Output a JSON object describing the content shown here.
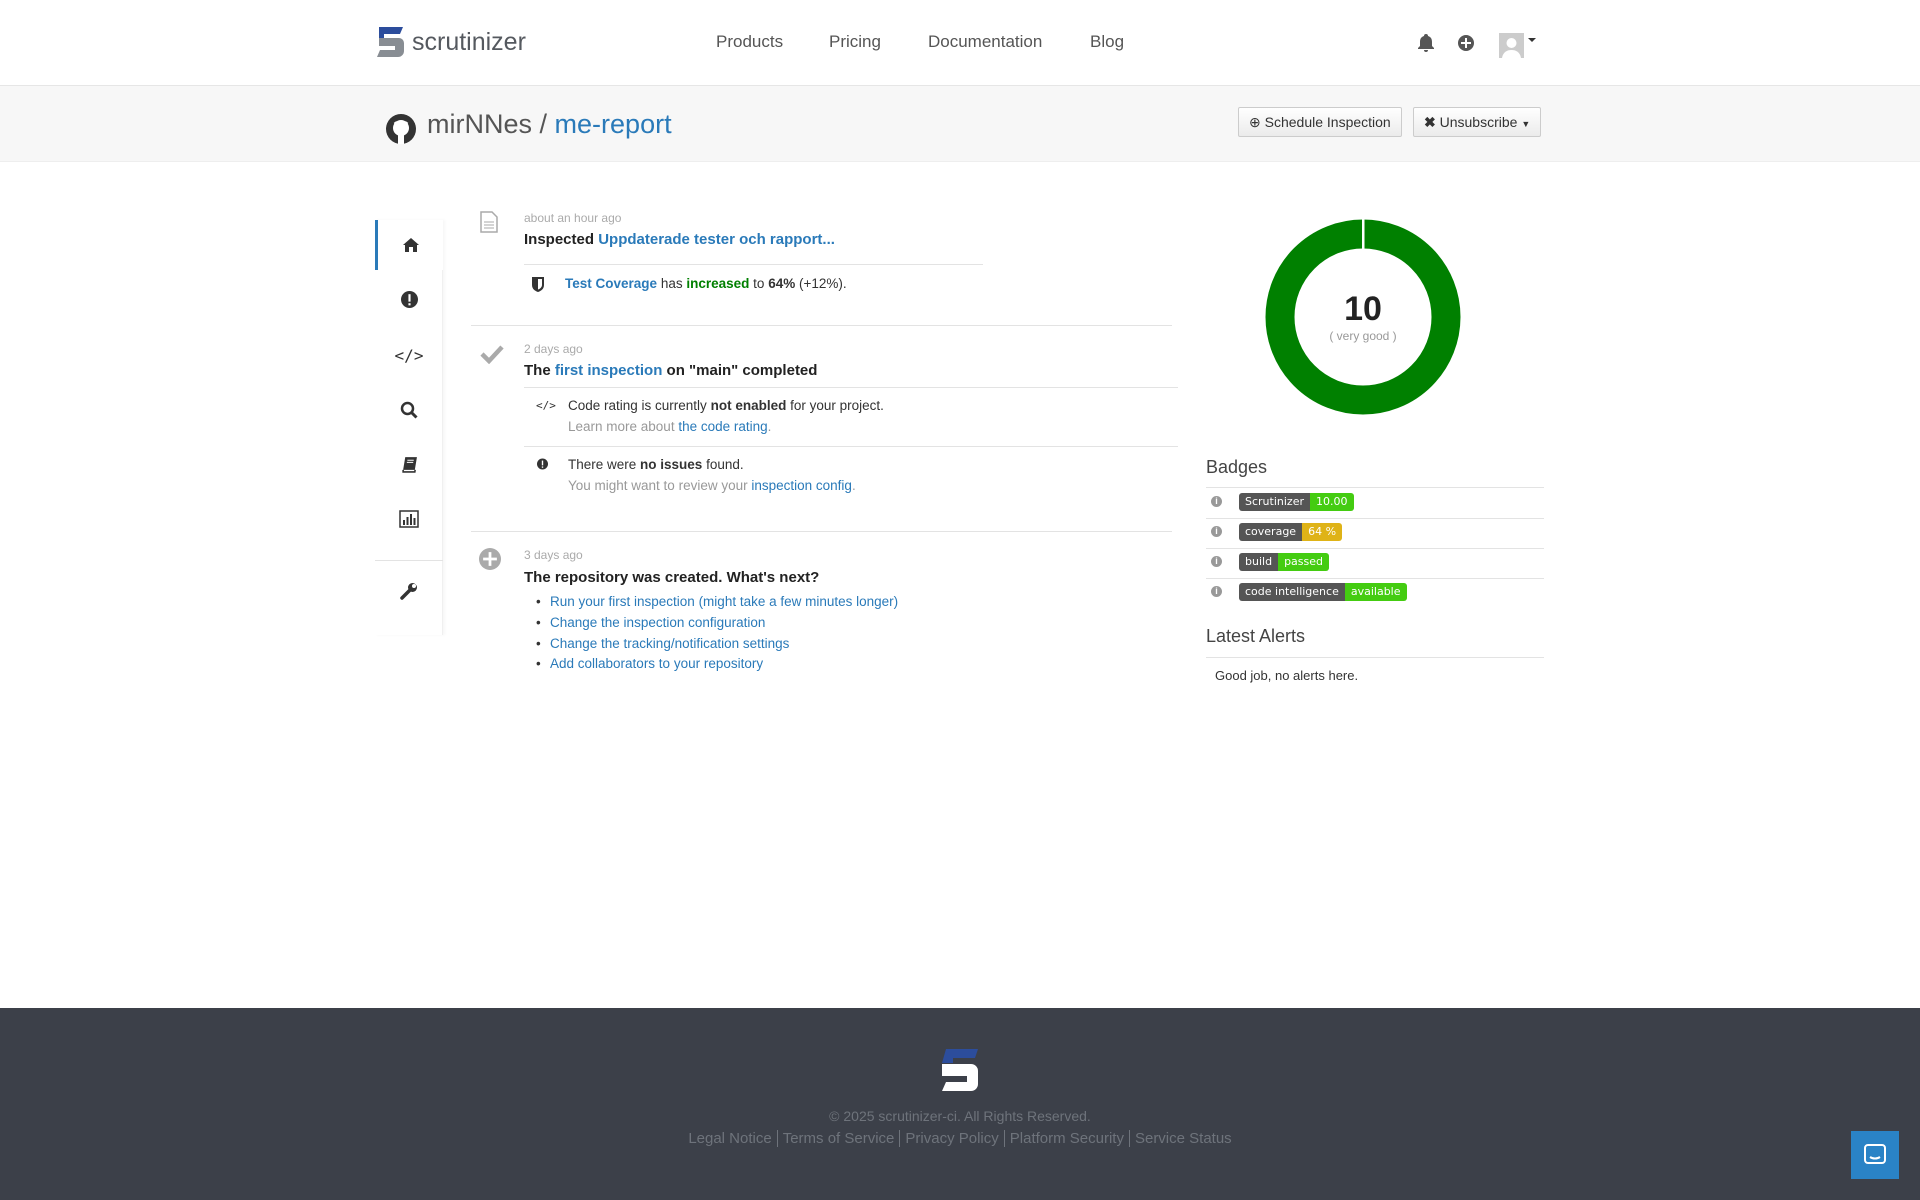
{
  "header": {
    "brand": "scrutinizer",
    "nav": [
      "Products",
      "Pricing",
      "Documentation",
      "Blog"
    ],
    "icons": [
      "bell-icon",
      "plus-circle-icon",
      "avatar"
    ]
  },
  "repo": {
    "owner": "mirNNes",
    "separator": "/",
    "name": "me-report",
    "schedule_label": "Schedule Inspection",
    "unsubscribe_label": "Unsubscribe"
  },
  "sidebar": {
    "items": [
      "home-icon",
      "issues-icon",
      "code-icon",
      "search-icon",
      "book-icon",
      "chart-icon",
      "wrench-icon"
    ],
    "active": "home-icon"
  },
  "feed": [
    {
      "time": "about an hour ago",
      "title_prefix": "Inspected",
      "title_link": "Uppdaterade tester och rapport...",
      "detail": {
        "link": "Test Coverage",
        "t1": "has",
        "highlight": "increased",
        "t2": "to",
        "value": "64%",
        "t3": "(+12%)."
      }
    },
    {
      "time": "2 days ago",
      "title_prefix": "The",
      "title_link": "first inspection",
      "title_suffix": "on \"main\" completed",
      "details": [
        {
          "t1": "Code rating is currently",
          "bold": "not enabled",
          "t2": "for your project.",
          "muted": "Learn more about",
          "link": "the code rating",
          "end": "."
        },
        {
          "t1": "There were",
          "bold": "no issues",
          "t2": "found.",
          "muted": "You might want to review your",
          "link": "inspection config",
          "end": "."
        }
      ]
    },
    {
      "time": "3 days ago",
      "title": "The repository was created. What's next?",
      "links": [
        "Run your first inspection (might take a few minutes longer)",
        "Change the inspection configuration",
        "Change the tracking/notification settings",
        "Add collaborators to your repository"
      ]
    }
  ],
  "rating": {
    "score": "10",
    "label": "( very good )",
    "fraction": 1.0,
    "color": "#008000"
  },
  "badges": {
    "heading": "Badges",
    "items": [
      {
        "left": "Scrutinizer",
        "right": "10.00",
        "color": "#44cc11"
      },
      {
        "left": "coverage",
        "right": "64 %",
        "color": "#dfb317"
      },
      {
        "left": "build",
        "right": "passed",
        "color": "#44cc11"
      },
      {
        "left": "code intelligence",
        "right": "available",
        "color": "#44cc11"
      }
    ]
  },
  "alerts": {
    "heading": "Latest Alerts",
    "text": "Good job, no alerts here."
  },
  "footer": {
    "copyright": "© 2025 scrutinizer-ci. All Rights Reserved.",
    "links": [
      "Legal Notice",
      "Terms of Service",
      "Privacy Policy",
      "Platform Security",
      "Service Status"
    ]
  }
}
